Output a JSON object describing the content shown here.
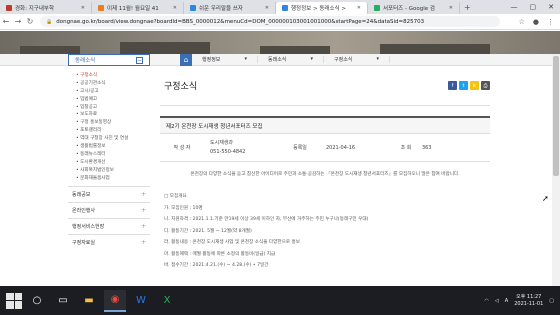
{
  "browser": {
    "tabs": [
      {
        "label": "경화: 지구내부학",
        "active": false,
        "color": "#c0392b"
      },
      {
        "label": "이제 11월! 월요일 41",
        "active": false,
        "color": "#e67e22"
      },
      {
        "label": "쉬운 우리말을 쓰자",
        "active": false,
        "color": "#2e86de"
      },
      {
        "label": "행정정보 > 동래소식 >",
        "active": true,
        "color": "#2e86de"
      },
      {
        "label": "서포터즈 - Google 검",
        "active": false,
        "color": "#27ae60"
      }
    ],
    "url": "dongnae.go.kr/board/view.dongnae?boardId=BBS_0000012&menuCd=DOM_000000103001001000&startPage=24&dataSid=825703"
  },
  "nav": {
    "dropdowns": [
      "행정정보",
      "동래소식",
      "구정소식"
    ]
  },
  "sidebar": {
    "header": "동래소식",
    "items": [
      "구정소식",
      "공공기관소식",
      "고시/공고",
      "입법예고",
      "입찰공고",
      "보도자료",
      "구정 홍보동영상",
      "포토갤러리",
      "역대 구청장 사진 및 연설",
      "생활법률정보",
      "동래뉴스레터",
      "도시환경개선",
      "사회복지법인정보",
      "문화재돌봄사업"
    ],
    "groups": [
      "동래공보",
      "온라인행사",
      "행정서비스헌장",
      "구정자료실"
    ]
  },
  "main": {
    "title": "구정소식",
    "post_title": "제2기 온천장 도시재생 청년서포터즈 모집",
    "author_label": "작 성 자",
    "author_dept": "도시재생과",
    "author_phone": "051-550-4842",
    "date_label": "등록일",
    "date": "2021-04-16",
    "views_label": "조 회",
    "views": "363",
    "intro": "온천장의 다양한 소식을 듣고 참신한 아이디어로 주민과 소통·공감하는 『온천장 도시재생 청년서포터즈』를 모집하오니 많은 참여 바랍니다.",
    "lines": [
      "□ 모집개요",
      "가. 모집인원 : 10명",
      "나. 지원자격 : 2021.1.1.기준 만19세 이상 39세 이하인 자, 부산에 거주하는 주민 누구나(동래구민 우대)",
      "다. 활동기간 : 2021. 5월 ~ 12월(약 8개월)",
      "라. 활동내용 : 온천장 도시재생 사업 및 온천장 소식을 다양한으로 홍보",
      "마. 활동혜택 : 매월 활동에 따른 소정의 활동비(일급) 지급",
      "바. 접수기간 : 2021.4.21.(수) ~ 4.28.(수) • 7일간"
    ]
  },
  "taskbar": {
    "time": "오후 11:27",
    "date": "2021-11-01",
    "lang": "A"
  }
}
